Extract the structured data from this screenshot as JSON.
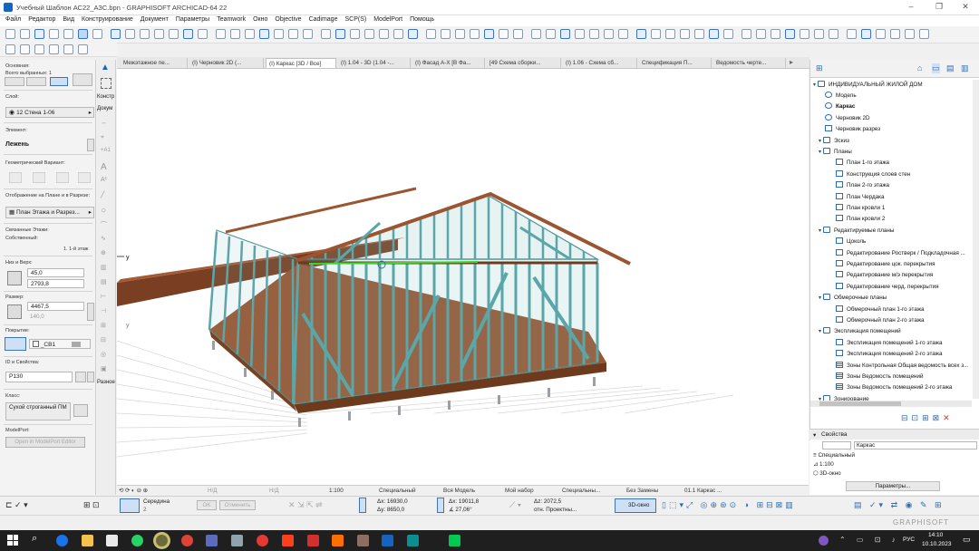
{
  "window": {
    "title": "Учебный Шаблон АС22_АЗС.bpn - GRAPHISOFT ARCHICAD-64 22"
  },
  "menu": [
    "Файл",
    "Редактор",
    "Вид",
    "Конструирование",
    "Документ",
    "Параметры",
    "Teamwork",
    "Окно",
    "Objective",
    "Cadimage",
    "SCP(S)",
    "ModelPort",
    "Помощь"
  ],
  "left_panel": {
    "osnovnaya": "Основная:",
    "vsego": "Всего выбранных: 1",
    "sloy_label": "Слой:",
    "sloy_value": "12 Стена 1-06",
    "element_label": "Элемент:",
    "element_value": "Лежень",
    "geom_label": "Геометрический Вариант:",
    "otobr_label": "Отображение на Плане и в Разрезе:",
    "otobr_value": "План Этажа и Разрез...",
    "svyaz_label": "Связанные Этажи:",
    "sobstv_label": "Собственный:",
    "sobstv_value": "1. 1-й этаж",
    "niz_label": "Низ и Верх:",
    "niz_value": "45,0",
    "verh_value": "2793,8",
    "razmer_label": "Размер:",
    "razmer_value": "4467,5",
    "razmer_value2": "140,0",
    "pokrytie_label": "Покрытие:",
    "pokrytie_value": "_СВ1",
    "id_label": "ID и Свойства:",
    "id_value": "Р130",
    "klass_label": "Класс:",
    "klass_value": "Сухой строганный ПМ",
    "modelport_label": "ModelPort:",
    "modelport_btn": "Open in ModelPort Editor"
  },
  "toolbox_labels": {
    "konstr": "Констр",
    "dokum": "Докум",
    "raznoe": "Разное"
  },
  "tabs": [
    "Межэтажное пе...",
    "(I) Черновик 2D (...",
    "(I) Каркас [3D / Все]",
    "(I) 1.04 - 3D (1.04 -...",
    "(I) Фасад А-Х [В Фа...",
    "[49 Схема сборки...",
    "(I) 1.06 - Схема сб...",
    "Спецификация П...",
    "Ведомость черте..."
  ],
  "viewport_axis": {
    "y1": "y",
    "y2": "y"
  },
  "view_bar": [
    "Н/Д",
    "Н/Д",
    "1:100",
    "Специальный",
    "Вся Модель",
    "Мой набор",
    "Специальны...",
    "Без Замены",
    "01.1 Каркас ..."
  ],
  "navigator": {
    "root": "ИНДИВИДУАЛЬНЫЙ ЖИЛОЙ ДОМ",
    "items": [
      {
        "label": "Модель",
        "level": 1,
        "icon": "globe-icon"
      },
      {
        "label": "Каркас",
        "level": 1,
        "icon": "globe-icon",
        "bold": true
      },
      {
        "label": "Черновик 2D",
        "level": 1,
        "icon": "globe-icon"
      },
      {
        "label": "Черновик разрез",
        "level": 1,
        "icon": "plan-icon"
      },
      {
        "label": "Эскиз",
        "level": 1,
        "icon": "folder-icon",
        "expand": true
      },
      {
        "label": "Планы",
        "level": 2,
        "icon": "folder-icon",
        "expand": true
      },
      {
        "label": "План 1-го этажа",
        "level": 3,
        "icon": "plan-icon"
      },
      {
        "label": "Конструкция слоев стен",
        "level": 3,
        "icon": "plan-icon"
      },
      {
        "label": "План 2-го этажа",
        "level": 3,
        "icon": "plan-icon"
      },
      {
        "label": "План Чердака",
        "level": 3,
        "icon": "plan-icon"
      },
      {
        "label": "План кровли 1",
        "level": 3,
        "icon": "plan-icon"
      },
      {
        "label": "План кровли 2",
        "level": 3,
        "icon": "plan-icon"
      },
      {
        "label": "Редактируемые планы",
        "level": 2,
        "icon": "folder-icon",
        "expand": true
      },
      {
        "label": "Цоколь",
        "level": 3,
        "icon": "plan-icon"
      },
      {
        "label": "Редактирование Ростверк / Подкладочная ...",
        "level": 3,
        "icon": "plan-icon"
      },
      {
        "label": "Редактирование цок. перекрытия",
        "level": 3,
        "icon": "plan-icon"
      },
      {
        "label": "Редактирование м/э перекрытия",
        "level": 3,
        "icon": "plan-icon"
      },
      {
        "label": "Редактирование черд. перекрытия",
        "level": 3,
        "icon": "plan-icon"
      },
      {
        "label": "Обмерочные планы",
        "level": 2,
        "icon": "folder-icon",
        "expand": true
      },
      {
        "label": "Обмерочный план 1-го этажа",
        "level": 3,
        "icon": "plan-icon"
      },
      {
        "label": "Обмерочный план 2-го этажа",
        "level": 3,
        "icon": "plan-icon"
      },
      {
        "label": "Экспликация помещений",
        "level": 2,
        "icon": "folder-icon",
        "expand": true
      },
      {
        "label": "Экспликация помещений 1-го этажа",
        "level": 3,
        "icon": "plan-icon"
      },
      {
        "label": "Экспликация помещений 2-го этажа",
        "level": 3,
        "icon": "plan-icon"
      },
      {
        "label": "Зоны Контрольная Общая ведомость всех з...",
        "level": 3,
        "icon": "sheet-icon"
      },
      {
        "label": "Зоны Ведомость помещений",
        "level": 3,
        "icon": "sheet-icon"
      },
      {
        "label": "Зоны Ведомость помещений 2-го этажа",
        "level": 3,
        "icon": "sheet-icon"
      },
      {
        "label": "Зонирование",
        "level": 2,
        "icon": "folder-icon",
        "expand": true
      }
    ]
  },
  "properties": {
    "header": "Свойства",
    "name": "Каркас",
    "type": "Специальный",
    "scale": "1:100",
    "view": "3D-окно",
    "params_btn": "Параметры..."
  },
  "info_bar": {
    "seredina": "Середина",
    "seredina_sub": "2",
    "ok": "OK",
    "cancel": "Отменить",
    "dx": "Δx: 16930,0",
    "dy": "Δy: 8650,0",
    "ax": "Δx: 19011,8",
    "ang": "∡ 27,06°",
    "dz": "Δz: 2072,5",
    "ref": "отн. Проектны...",
    "window3d": "3D-окно",
    "brand": "GRAPHISOFT"
  },
  "taskbar": {
    "lang": "РУС",
    "time": "14:10",
    "date": "10.10.2023"
  },
  "colors": {
    "accent": "#1565c0",
    "frame": "#5aa6a8",
    "wood": "#8a4a2a",
    "select": "#3ad62a",
    "taskbar": "#1f1f1f"
  }
}
